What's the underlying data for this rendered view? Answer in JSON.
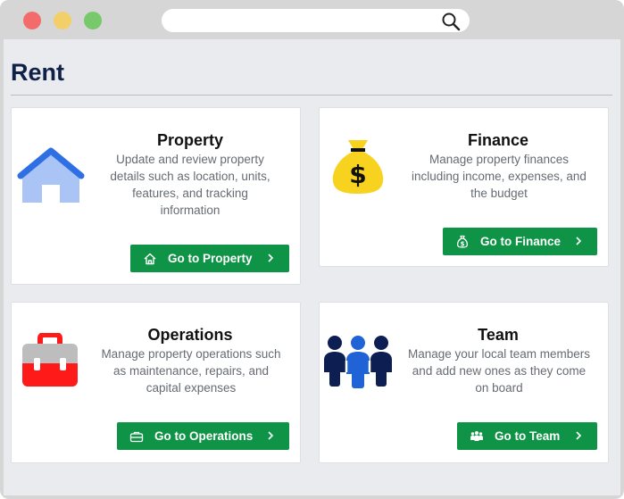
{
  "page": {
    "title": "Rent"
  },
  "cards": {
    "property": {
      "title": "Property",
      "description": "Update and review property details such as location, units, features, and tracking information",
      "button_label": "Go to Property",
      "icon": "house-icon",
      "button_icon": "home-outline-icon"
    },
    "finance": {
      "title": "Finance",
      "description": "Manage property finances including income, expenses, and the budget",
      "button_label": "Go to Finance",
      "icon": "money-bag-icon",
      "button_icon": "money-bag-outline-icon"
    },
    "operations": {
      "title": "Operations",
      "description": "Manage property operations such as maintenance, repairs, and capital expenses",
      "button_label": "Go to Operations",
      "icon": "toolbox-icon",
      "button_icon": "toolbox-outline-icon"
    },
    "team": {
      "title": "Team",
      "description": "Manage your local team members and add new ones as they come on board",
      "button_label": "Go to Team",
      "icon": "team-icon",
      "button_icon": "people-icon"
    }
  },
  "colors": {
    "title": "#0f2148",
    "button": "#0f9346",
    "background": "#e9ebee"
  }
}
